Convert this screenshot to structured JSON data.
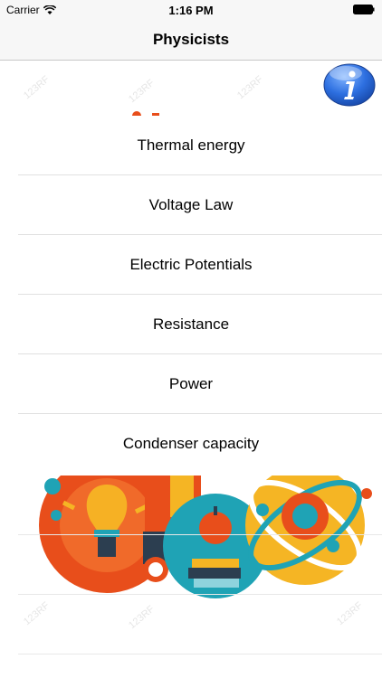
{
  "status_bar": {
    "carrier": "Carrier",
    "time": "1:16 PM"
  },
  "nav": {
    "title": "Physicists"
  },
  "info_button": {
    "icon": "info-icon",
    "color": "#2d6fe0"
  },
  "list": {
    "items": [
      {
        "label": "Thermal energy"
      },
      {
        "label": "Voltage Law"
      },
      {
        "label": "Electric Potentials"
      },
      {
        "label": "Resistance"
      },
      {
        "label": "Power"
      },
      {
        "label": "Condenser capacity"
      }
    ]
  },
  "colors": {
    "orange": "#e84e1b",
    "yellow": "#f5b524",
    "teal": "#1fa3b5",
    "navy": "#2c3e50"
  }
}
